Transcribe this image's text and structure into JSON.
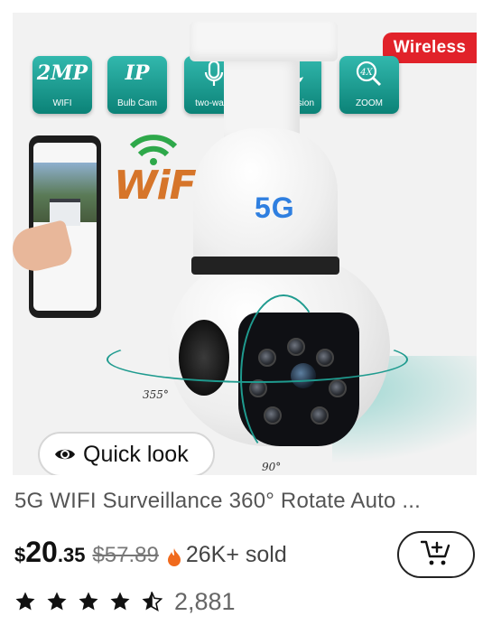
{
  "badge": {
    "text": "Wireless",
    "color": "#e1222a"
  },
  "features": [
    {
      "big": "2MP",
      "small": "WIFI",
      "icon": null
    },
    {
      "big": "IP",
      "small": "Bulb Cam",
      "icon": null
    },
    {
      "big": "",
      "small": "two-ways",
      "icon": "microphone-icon"
    },
    {
      "big": "",
      "small": "night vision",
      "icon": "moon-icon"
    },
    {
      "big": "4X",
      "small": "ZOOM",
      "icon": "zoom-icon"
    }
  ],
  "image_text": {
    "wifi": "WiFi",
    "model": "5G",
    "rotation_horizontal": "355°",
    "rotation_vertical": "90°"
  },
  "quick_look": {
    "label": "Quick look",
    "icon": "eye-icon"
  },
  "product": {
    "title": "5G WIFI Surveillance 360° Rotate Auto ...",
    "price_currency": "$",
    "price_whole": "20",
    "price_cents": ".35",
    "original_price": "$57.89",
    "sold": "26K+ sold",
    "rating_stars": 4.5,
    "review_count": "2,881"
  },
  "colors": {
    "accent_teal": "#1f9b8f",
    "sale_red": "#e1222a",
    "fire_orange": "#f06a1d"
  }
}
